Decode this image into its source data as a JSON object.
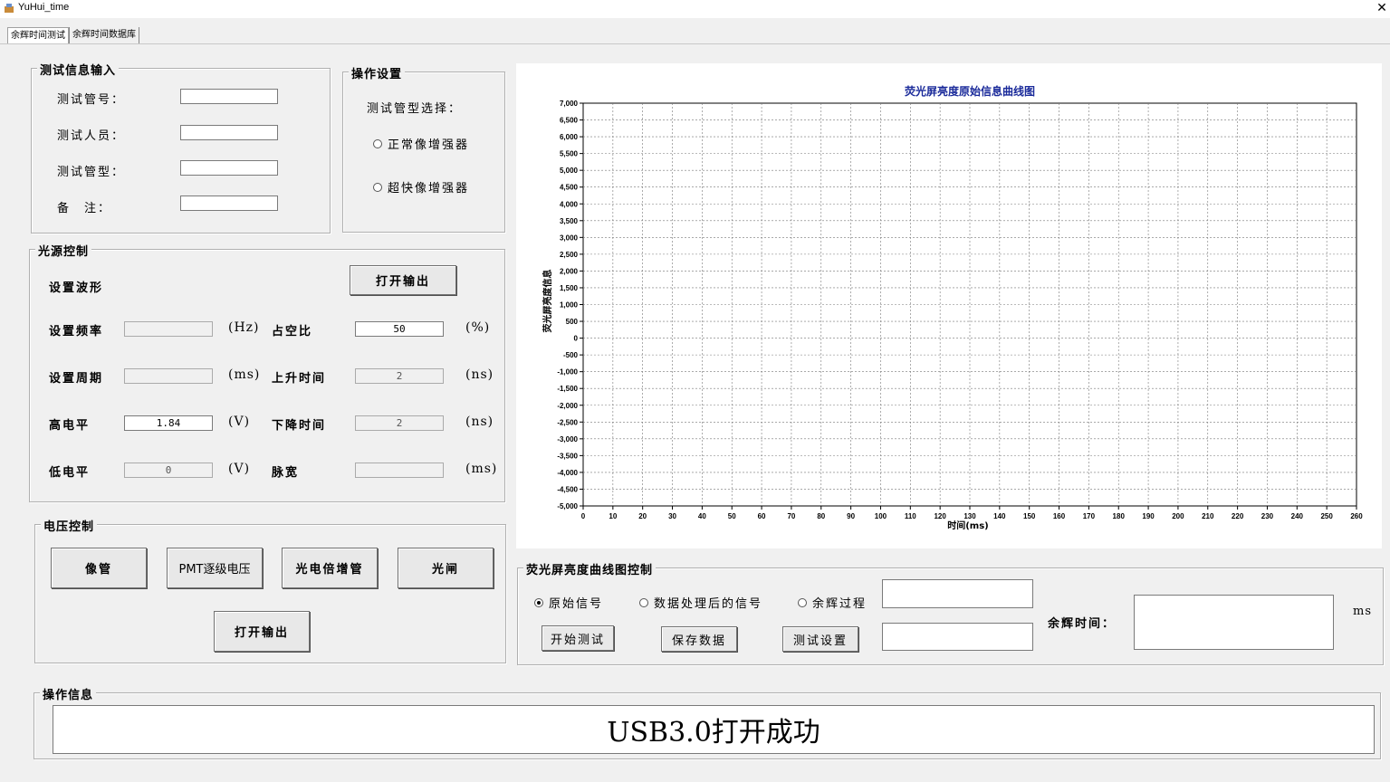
{
  "window": {
    "title": "YuHui_time",
    "close": "✕"
  },
  "tabs": [
    "余辉时间测试",
    "余辉时间数据库"
  ],
  "test_info": {
    "legend": "测试信息输入",
    "fields": [
      {
        "label": "测试管号：",
        "value": ""
      },
      {
        "label": "测试人员：",
        "value": ""
      },
      {
        "label": "测试管型：",
        "value": ""
      },
      {
        "label": "备　注：",
        "value": ""
      }
    ]
  },
  "operation_settings": {
    "legend": "操作设置",
    "prompt": "测试管型选择：",
    "options": [
      {
        "label": "正常像增强器",
        "checked": false
      },
      {
        "label": "超快像增强器",
        "checked": false
      }
    ]
  },
  "light_source": {
    "legend": "光源控制",
    "waveform_label": "设置波形",
    "open_button": "打开输出",
    "freq": {
      "label": "设置频率",
      "value": "",
      "unit": "(Hz)"
    },
    "duty": {
      "label": "占空比",
      "value": "50",
      "unit": "(%)"
    },
    "period": {
      "label": "设置周期",
      "value": "",
      "unit": "(ms)"
    },
    "rise": {
      "label": "上升时间",
      "value": "2",
      "unit": "(ns)"
    },
    "high": {
      "label": "高电平",
      "value": "1.84",
      "unit": "(V)"
    },
    "fall": {
      "label": "下降时间",
      "value": "2",
      "unit": "(ns)"
    },
    "low": {
      "label": "低电平",
      "value": "0",
      "unit": "(V)"
    },
    "pulse": {
      "label": "脉宽",
      "value": "",
      "unit": "(ms)"
    }
  },
  "voltage_control": {
    "legend": "电压控制",
    "buttons": [
      "像管",
      "PMT逐级电压",
      "光电倍增管",
      "光闸"
    ],
    "open_button": "打开输出"
  },
  "curve_control": {
    "legend": "荧光屏亮度曲线图控制",
    "radios": [
      {
        "label": "原始信号",
        "checked": true
      },
      {
        "label": "数据处理后的信号",
        "checked": false
      },
      {
        "label": "余辉过程",
        "checked": false
      }
    ],
    "buttons": [
      "开始测试",
      "保存数据",
      "测试设置"
    ],
    "afterglow_label": "余辉时间：",
    "afterglow_unit": "ms"
  },
  "operation_info": {
    "legend": "操作信息",
    "message": "USB3.0打开成功"
  },
  "colors": {
    "chart_title": "#1a2a9a",
    "background": "#f0f0f0"
  },
  "chart_data": {
    "type": "line",
    "title": "荧光屏亮度原始信息曲线图",
    "xlabel": "时间(ms)",
    "ylabel": "荧光屏亮度信息",
    "xlim": [
      0,
      260
    ],
    "ylim": [
      -5000,
      7000
    ],
    "x_ticks": [
      0,
      10,
      20,
      30,
      40,
      50,
      60,
      70,
      80,
      90,
      100,
      110,
      120,
      130,
      140,
      150,
      160,
      170,
      180,
      190,
      200,
      210,
      220,
      230,
      240,
      250,
      260
    ],
    "y_ticks": [
      "7,000",
      "6,500",
      "6,000",
      "5,500",
      "5,000",
      "4,500",
      "4,000",
      "3,500",
      "3,000",
      "2,500",
      "2,000",
      "1,500",
      "1,000",
      "500",
      "0",
      "-500",
      "-1,000",
      "-1,500",
      "-2,000",
      "-2,500",
      "-3,000",
      "-3,500",
      "-4,000",
      "-4,500",
      "-5,000"
    ],
    "grid": true,
    "series": []
  }
}
